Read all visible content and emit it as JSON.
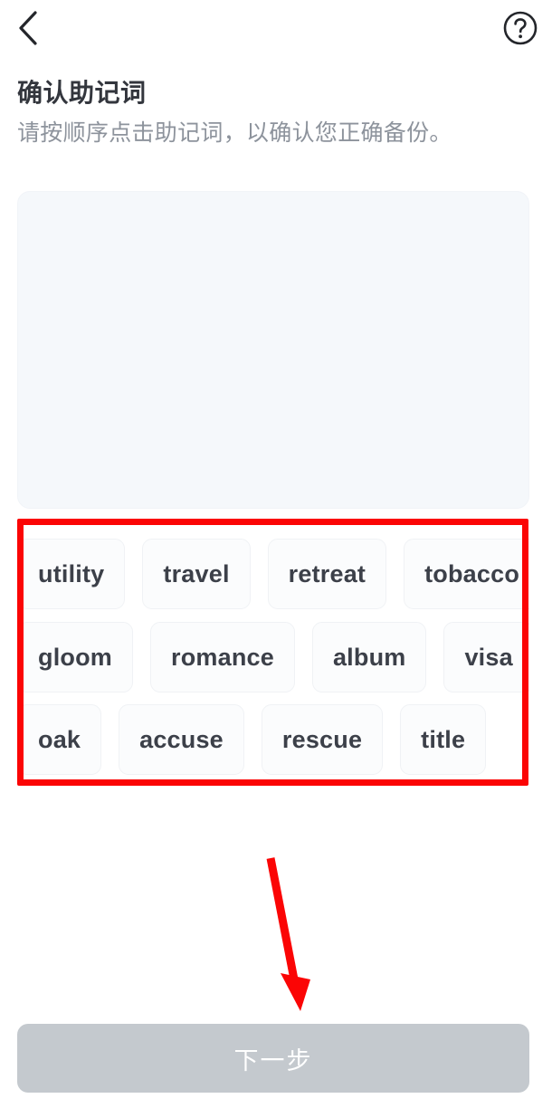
{
  "header": {
    "back_icon": "chevron-left-icon",
    "help_icon": "question-circle-icon"
  },
  "page": {
    "title": "确认助记词",
    "subtitle": "请按顺序点击助记词，以确认您正确备份。"
  },
  "answer_panel": {
    "selected_words": [],
    "background_color": "#f5f8fb"
  },
  "word_bank": {
    "rows": [
      [
        {
          "label": "utility"
        },
        {
          "label": "travel"
        },
        {
          "label": "retreat"
        },
        {
          "label": "tobacco"
        }
      ],
      [
        {
          "label": "gloom"
        },
        {
          "label": "romance"
        },
        {
          "label": "album"
        },
        {
          "label": "visa"
        }
      ],
      [
        {
          "label": "oak"
        },
        {
          "label": "accuse"
        },
        {
          "label": "rescue"
        },
        {
          "label": "title"
        }
      ]
    ]
  },
  "footer": {
    "next_label": "下一步",
    "next_disabled": true,
    "next_color": "#c4c9ce"
  },
  "annotations": {
    "highlight_color": "#fb0505",
    "box_target": "word-bank",
    "arrow_target": "next-button"
  }
}
